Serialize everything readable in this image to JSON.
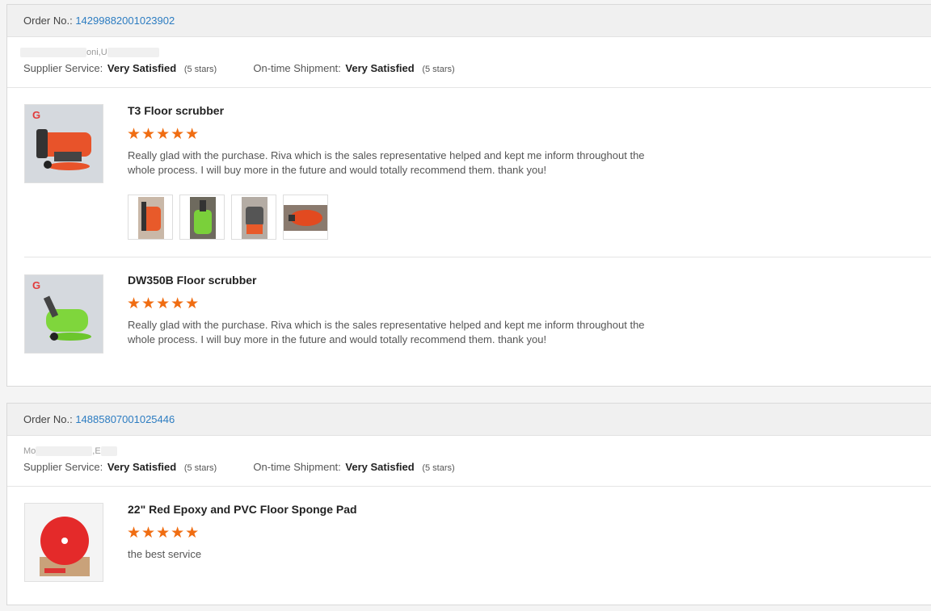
{
  "orders": [
    {
      "order_label": "Order No.:",
      "order_no": "14299882001023902",
      "buyer": "oni,U",
      "supplier_service_label": "Supplier Service:",
      "supplier_service_value": "Very Satisfied",
      "supplier_service_stars": "(5 stars)",
      "shipment_label": "On-time Shipment:",
      "shipment_value": "Very Satisfied",
      "shipment_stars": "(5 stars)",
      "items": [
        {
          "name": "T3 Floor scrubber",
          "rating": 5,
          "stars": "★★★★★",
          "review": "Really glad with the purchase. Riva which is the sales representative helped and kept me inform throughout the whole process. I will buy more in the future and would totally recommend them. thank you!",
          "photo_count": 4
        },
        {
          "name": "DW350B Floor scrubber",
          "rating": 5,
          "stars": "★★★★★",
          "review": "Really glad with the purchase. Riva which is the sales representative helped and kept me inform throughout the whole process. I will buy more in the future and would totally recommend them. thank you!"
        }
      ]
    },
    {
      "order_label": "Order No.:",
      "order_no": "14885807001025446",
      "buyer_prefix": "Mo",
      "buyer_suffix": ",E",
      "supplier_service_label": "Supplier Service:",
      "supplier_service_value": "Very Satisfied",
      "supplier_service_stars": "(5 stars)",
      "shipment_label": "On-time Shipment:",
      "shipment_value": "Very Satisfied",
      "shipment_stars": "(5 stars)",
      "items": [
        {
          "name": "22\" Red Epoxy and PVC Floor Sponge Pad",
          "rating": 5,
          "stars": "★★★★★",
          "review": "the best service"
        }
      ]
    }
  ],
  "colors": {
    "star": "#f06d12",
    "link": "#2c7cc1"
  }
}
